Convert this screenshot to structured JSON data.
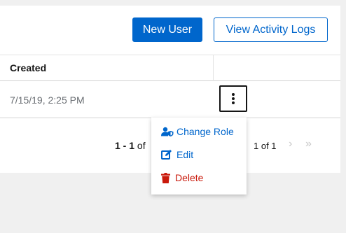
{
  "toolbar": {
    "new_user_label": "New User",
    "view_activity_logs_label": "View Activity Logs"
  },
  "table": {
    "columns": [
      "Created",
      ""
    ],
    "rows": [
      {
        "created": "7/15/19, 2:25 PM"
      }
    ]
  },
  "actions_menu": {
    "items": [
      {
        "label": "Change Role",
        "icon": "user-shield-icon",
        "color": "#0066cc"
      },
      {
        "label": "Edit",
        "icon": "edit-icon",
        "color": "#0066cc"
      },
      {
        "label": "Delete",
        "icon": "trash-icon",
        "color": "#c9190b"
      }
    ]
  },
  "pagination": {
    "range_label": "1 - 1",
    "of_label": "of",
    "pages_label": "1 of 1"
  },
  "colors": {
    "primary": "#0066cc",
    "danger": "#c9190b",
    "background": "#f0f0f0"
  }
}
